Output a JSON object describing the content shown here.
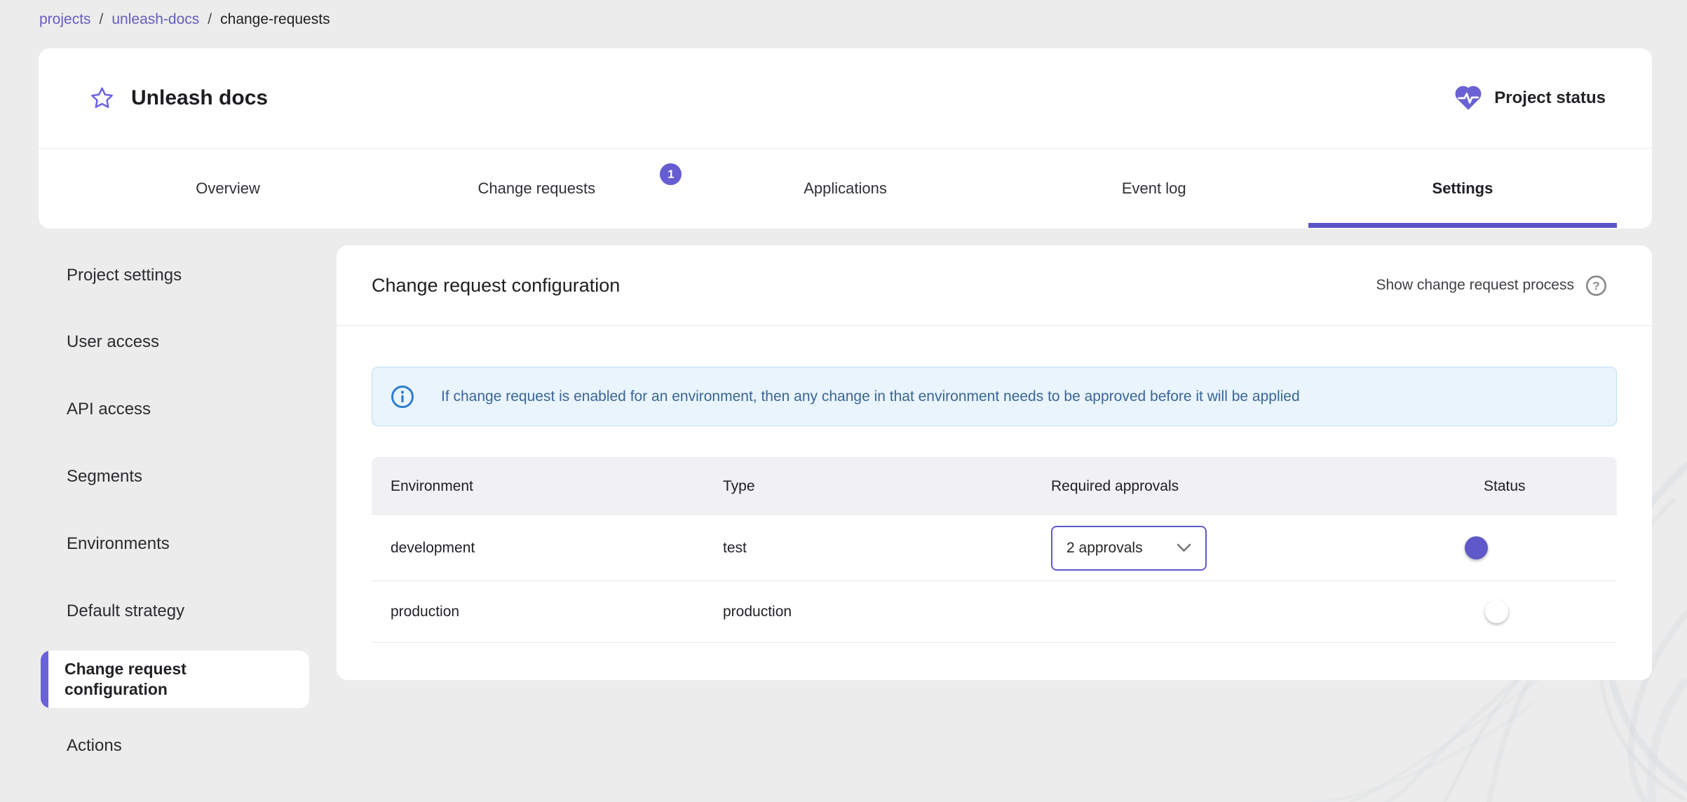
{
  "breadcrumb": {
    "separator": "/",
    "items": [
      {
        "label": "projects",
        "type": "link"
      },
      {
        "label": "unleash-docs",
        "type": "link"
      },
      {
        "label": "change-requests",
        "type": "current"
      }
    ]
  },
  "header": {
    "title": "Unleash docs",
    "favorite_icon": "star-outline-icon",
    "project_status": {
      "label": "Project status",
      "icon": "heart-pulse-icon"
    }
  },
  "tabs": {
    "items": [
      {
        "label": "Overview",
        "active": false
      },
      {
        "label": "Change requests",
        "active": false,
        "badge": "1"
      },
      {
        "label": "Applications",
        "active": false
      },
      {
        "label": "Event log",
        "active": false
      },
      {
        "label": "Settings",
        "active": true
      }
    ]
  },
  "sidebar": {
    "items": [
      {
        "label": "Project settings",
        "active": false
      },
      {
        "label": "User access",
        "active": false
      },
      {
        "label": "API access",
        "active": false
      },
      {
        "label": "Segments",
        "active": false
      },
      {
        "label": "Environments",
        "active": false
      },
      {
        "label": "Default strategy",
        "active": false
      },
      {
        "label": "Change request configuration",
        "active": true
      },
      {
        "label": "Actions",
        "active": false
      }
    ]
  },
  "main": {
    "title": "Change request configuration",
    "help_link": {
      "label": "Show change request process",
      "icon": "help-circle-icon"
    },
    "alert": {
      "icon": "info-icon",
      "text": "If change request is enabled for an environment, then any change in that environment needs to be approved before it will be applied"
    },
    "table": {
      "columns": [
        "Environment",
        "Type",
        "Required approvals",
        "Status"
      ],
      "rows": [
        {
          "environment": "development",
          "type": "test",
          "required_approvals": "2 approvals",
          "status_enabled": true
        },
        {
          "environment": "production",
          "type": "production",
          "required_approvals": "",
          "status_enabled": false
        }
      ]
    }
  },
  "decor": {
    "background_art": "smoke-feather-texture"
  },
  "colors": {
    "primary": "#615bc8",
    "tab_indicator": "#5b53c6",
    "badge_bg": "#655dd1",
    "toggle_on_thumb": "#5f58c8",
    "toggle_on_track": "#b2ace9",
    "toggle_off_track": "#a5a5a5",
    "select_border": "#6259ce",
    "alert_bg": "#e9f4fc",
    "alert_border": "#bcdef5",
    "alert_text": "#3a6596",
    "alert_icon": "#2e7cd0",
    "page_bg": "#ececec",
    "table_header_bg": "#f1f1f4",
    "text_primary": "#202024"
  }
}
